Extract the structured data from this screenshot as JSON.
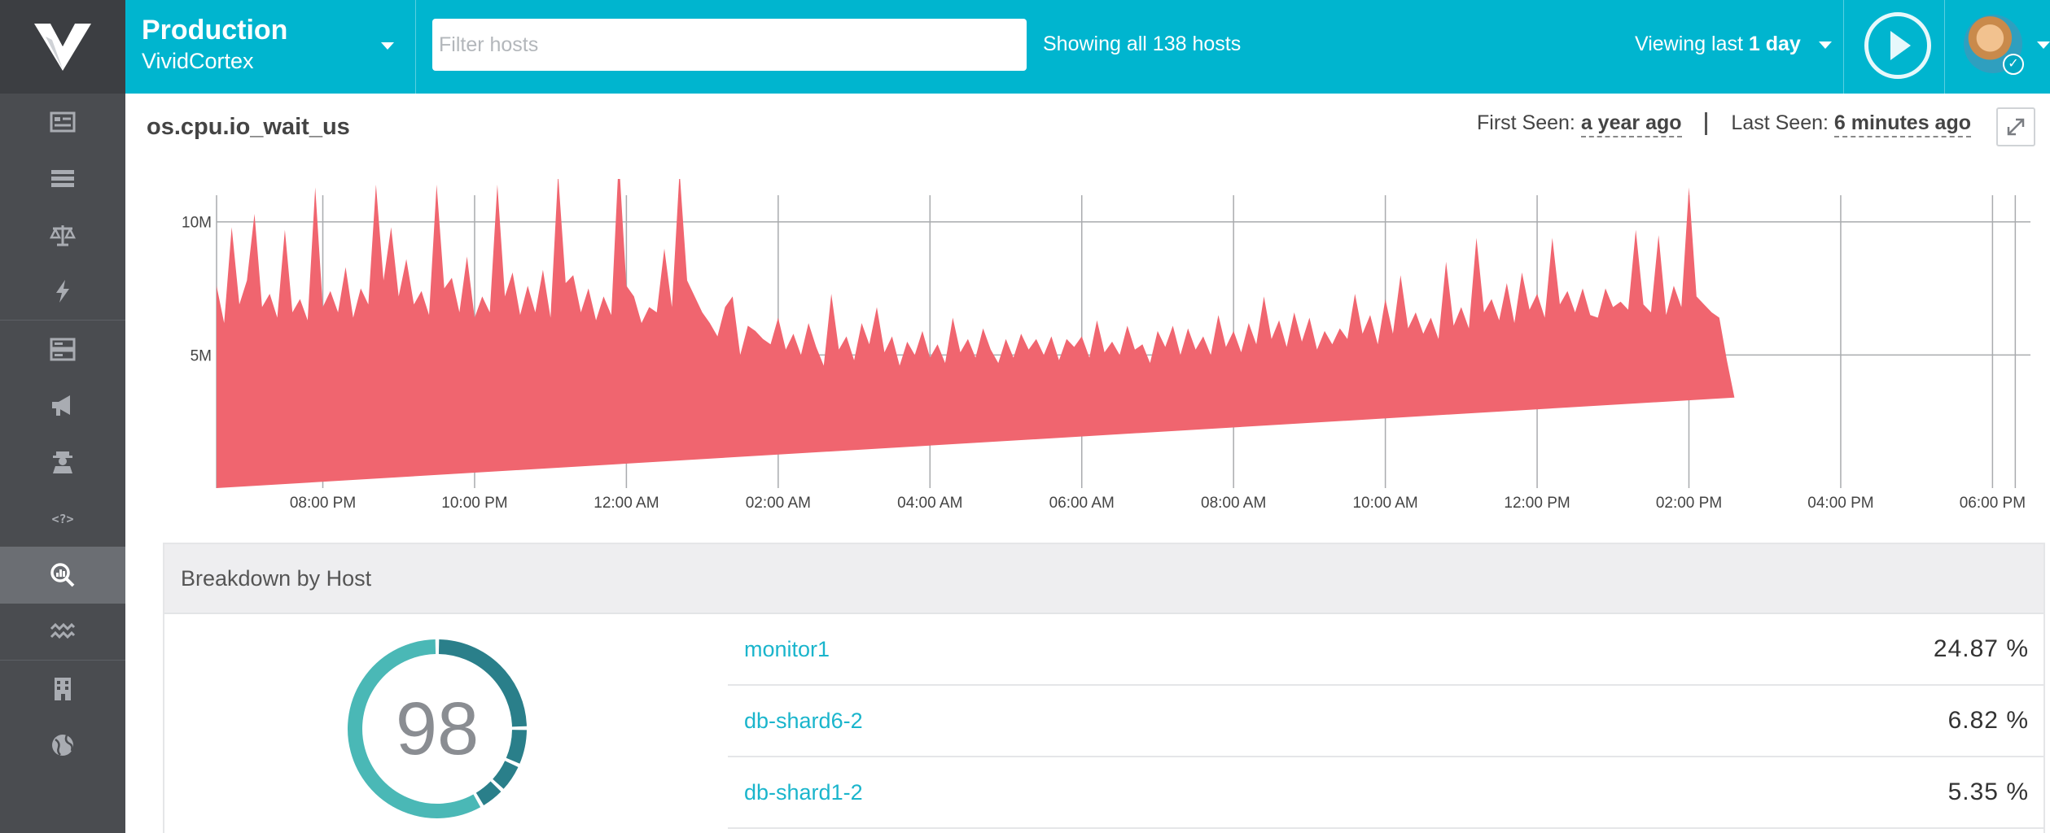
{
  "header": {
    "environment_title": "Production",
    "environment_subtitle": "VividCortex",
    "filter_placeholder": "Filter hosts",
    "hosts_count_text": "Showing all 138 hosts",
    "viewing_prefix": "Viewing last",
    "viewing_value": "1 day"
  },
  "sidebar": {
    "items": [
      {
        "icon": "list-icon"
      },
      {
        "icon": "table-icon"
      },
      {
        "icon": "scales-icon"
      },
      {
        "icon": "lightning-icon"
      },
      {
        "icon": "server-icon"
      },
      {
        "icon": "megaphone-icon"
      },
      {
        "icon": "agent-icon"
      },
      {
        "icon": "code-query-icon"
      },
      {
        "icon": "metrics-search-icon",
        "active": true
      },
      {
        "icon": "wave-icon"
      },
      {
        "icon": "building-icon"
      },
      {
        "icon": "globe-icon"
      }
    ]
  },
  "metric": {
    "name": "os.cpu.io_wait_us",
    "first_seen_label": "First Seen:",
    "first_seen_value": "a year ago",
    "last_seen_label": "Last Seen:",
    "last_seen_value": "6 minutes ago"
  },
  "chart_data": {
    "type": "area",
    "title": "",
    "xlabel": "",
    "ylabel": "",
    "y_ticks": [
      "5M",
      "10M"
    ],
    "y_tick_values": [
      5000000,
      10000000
    ],
    "x_ticks": [
      "08:00 PM",
      "10:00 PM",
      "12:00 AM",
      "02:00 AM",
      "04:00 AM",
      "06:00 AM",
      "08:00 AM",
      "10:00 AM",
      "12:00 PM",
      "02:00 PM",
      "04:00 PM",
      "06:00 PM"
    ],
    "x_range_hours": [
      -1.4,
      22.5
    ],
    "ylim": [
      0,
      11000000
    ],
    "grid": true,
    "color": "#f0656f",
    "series": [
      {
        "x_hours": [
          -1.4,
          -1.3,
          -1.2,
          -1.1,
          -1.0,
          -0.9,
          -0.8,
          -0.7,
          -0.6,
          -0.5,
          -0.4,
          -0.3,
          -0.2,
          -0.1,
          0.0,
          0.1,
          0.2,
          0.3,
          0.4,
          0.5,
          0.6,
          0.7,
          0.8,
          0.9,
          1.0,
          1.1,
          1.2,
          1.3,
          1.4,
          1.5,
          1.6,
          1.7,
          1.8,
          1.9,
          2.0,
          2.1,
          2.2,
          2.3,
          2.4,
          2.5,
          2.6,
          2.7,
          2.8,
          2.9,
          3.0,
          3.1,
          3.2,
          3.3,
          3.4,
          3.5,
          3.6,
          3.7,
          3.8,
          3.9,
          4.0,
          4.1,
          4.2,
          4.3,
          4.4,
          4.5,
          4.6,
          4.7,
          4.8,
          4.9,
          5.0,
          5.1,
          5.2,
          5.3,
          5.4,
          5.5,
          5.6,
          5.7,
          5.8,
          5.9,
          6.0,
          6.1,
          6.2,
          6.3,
          6.4,
          6.5,
          6.6,
          6.7,
          6.8,
          6.9,
          7.0,
          7.1,
          7.2,
          7.3,
          7.4,
          7.5,
          7.6,
          7.7,
          7.8,
          7.9,
          8.0,
          8.1,
          8.2,
          8.3,
          8.4,
          8.5,
          8.6,
          8.7,
          8.8,
          8.9,
          9.0,
          9.1,
          9.2,
          9.3,
          9.4,
          9.5,
          9.6,
          9.7,
          9.8,
          9.9,
          10.0,
          10.1,
          10.2,
          10.3,
          10.4,
          10.5,
          10.6,
          10.7,
          10.8,
          10.9,
          11.0,
          11.1,
          11.2,
          11.3,
          11.4,
          11.5,
          11.6,
          11.7,
          11.8,
          11.9,
          12.0,
          12.1,
          12.2,
          12.3,
          12.4,
          12.5,
          12.6,
          12.7,
          12.8,
          12.9,
          13.0,
          13.1,
          13.2,
          13.3,
          13.4,
          13.5,
          13.6,
          13.7,
          13.8,
          13.9,
          14.0,
          14.1,
          14.2,
          14.3,
          14.4,
          14.5,
          14.6,
          14.7,
          14.8,
          14.9,
          15.0,
          15.1,
          15.2,
          15.3,
          15.4,
          15.5,
          15.6,
          15.7,
          15.8,
          15.9,
          16.0,
          16.1,
          16.2,
          16.3,
          16.4,
          16.5,
          16.6,
          16.7,
          16.8,
          16.9,
          17.0,
          17.1,
          17.2,
          17.3,
          17.4,
          17.5,
          17.6,
          17.7,
          17.8,
          17.9,
          18.0,
          18.1,
          18.2,
          18.3,
          18.4,
          18.5,
          18.6,
          18.7,
          18.8,
          18.9,
          19.0,
          19.1,
          19.2,
          19.3,
          19.4,
          19.5,
          19.6,
          19.7,
          19.8,
          19.9,
          20.0,
          20.1,
          20.2,
          20.3,
          20.4,
          20.5,
          20.6,
          20.7,
          20.8,
          20.9,
          21.0,
          21.1,
          21.2,
          21.3,
          21.4,
          21.5,
          21.6,
          21.7,
          21.8,
          21.9,
          22.0,
          22.1,
          22.2,
          22.3,
          22.4,
          22.5
        ],
        "values": [
          7600000,
          6200000,
          9800000,
          6900000,
          7800000,
          10300000,
          6800000,
          7300000,
          6400000,
          9700000,
          6600000,
          7100000,
          6300000,
          11300000,
          6800000,
          7400000,
          6600000,
          8300000,
          6400000,
          7500000,
          6900000,
          11400000,
          7800000,
          9800000,
          7200000,
          8600000,
          6900000,
          7400000,
          6500000,
          11400000,
          7500000,
          7900000,
          6600000,
          8700000,
          6400000,
          7200000,
          6600000,
          11400000,
          7200000,
          8100000,
          6500000,
          7600000,
          6600000,
          8200000,
          6400000,
          11800000,
          7700000,
          8000000,
          6600000,
          7500000,
          6300000,
          7200000,
          6500000,
          12400000,
          7600000,
          7200000,
          6200000,
          6800000,
          6600000,
          9000000,
          6800000,
          11900000,
          7800000,
          7200000,
          6600000,
          6200000,
          5700000,
          6800000,
          7200000,
          5000000,
          6100000,
          5900000,
          5600000,
          5400000,
          6400000,
          5200000,
          5800000,
          5000000,
          6200000,
          5300000,
          4600000,
          7300000,
          5200000,
          5700000,
          4800000,
          6200000,
          5400000,
          6800000,
          5100000,
          5700000,
          4600000,
          5500000,
          5000000,
          5900000,
          4900000,
          5400000,
          4700000,
          6400000,
          5100000,
          5600000,
          4900000,
          6000000,
          5200000,
          4700000,
          5600000,
          4900000,
          5800000,
          5200000,
          5600000,
          5000000,
          5700000,
          4800000,
          5600000,
          5300000,
          5700000,
          4900000,
          6300000,
          5100000,
          5500000,
          5000000,
          6100000,
          5200000,
          5400000,
          4700000,
          5900000,
          5300000,
          6100000,
          5000000,
          6000000,
          5200000,
          5700000,
          5000000,
          6500000,
          5300000,
          5900000,
          5100000,
          6200000,
          5400000,
          7200000,
          5600000,
          6300000,
          5300000,
          6600000,
          5500000,
          6400000,
          5200000,
          5900000,
          5400000,
          6000000,
          5600000,
          7300000,
          5800000,
          6500000,
          5400000,
          7100000,
          5800000,
          8000000,
          6000000,
          6600000,
          5800000,
          6400000,
          5600000,
          8500000,
          6100000,
          6800000,
          6000000,
          9400000,
          6600000,
          7100000,
          6300000,
          7700000,
          6200000,
          8100000,
          6700000,
          7300000,
          6400000,
          9400000,
          6900000,
          7400000,
          6600000,
          7500000,
          6500000,
          6400000,
          7500000,
          6800000,
          7000000,
          6700000,
          9700000,
          6900000,
          6600000,
          9500000,
          6500000,
          7600000,
          6800000,
          11300000,
          7200000,
          6900000,
          6600000,
          6400000,
          4800000,
          3400000
        ],
        "x_step_hours": 0.1
      }
    ]
  },
  "breakdown": {
    "title": "Breakdown by Host",
    "host_count": "98",
    "donut_segments": [
      24.87,
      6.82,
      5.35,
      4.6,
      58.36
    ],
    "hosts": [
      {
        "name": "monitor1",
        "percent": "24.87 %"
      },
      {
        "name": "db-shard6-2",
        "percent": "6.82 %"
      },
      {
        "name": "db-shard1-2",
        "percent": "5.35 %"
      }
    ]
  }
}
